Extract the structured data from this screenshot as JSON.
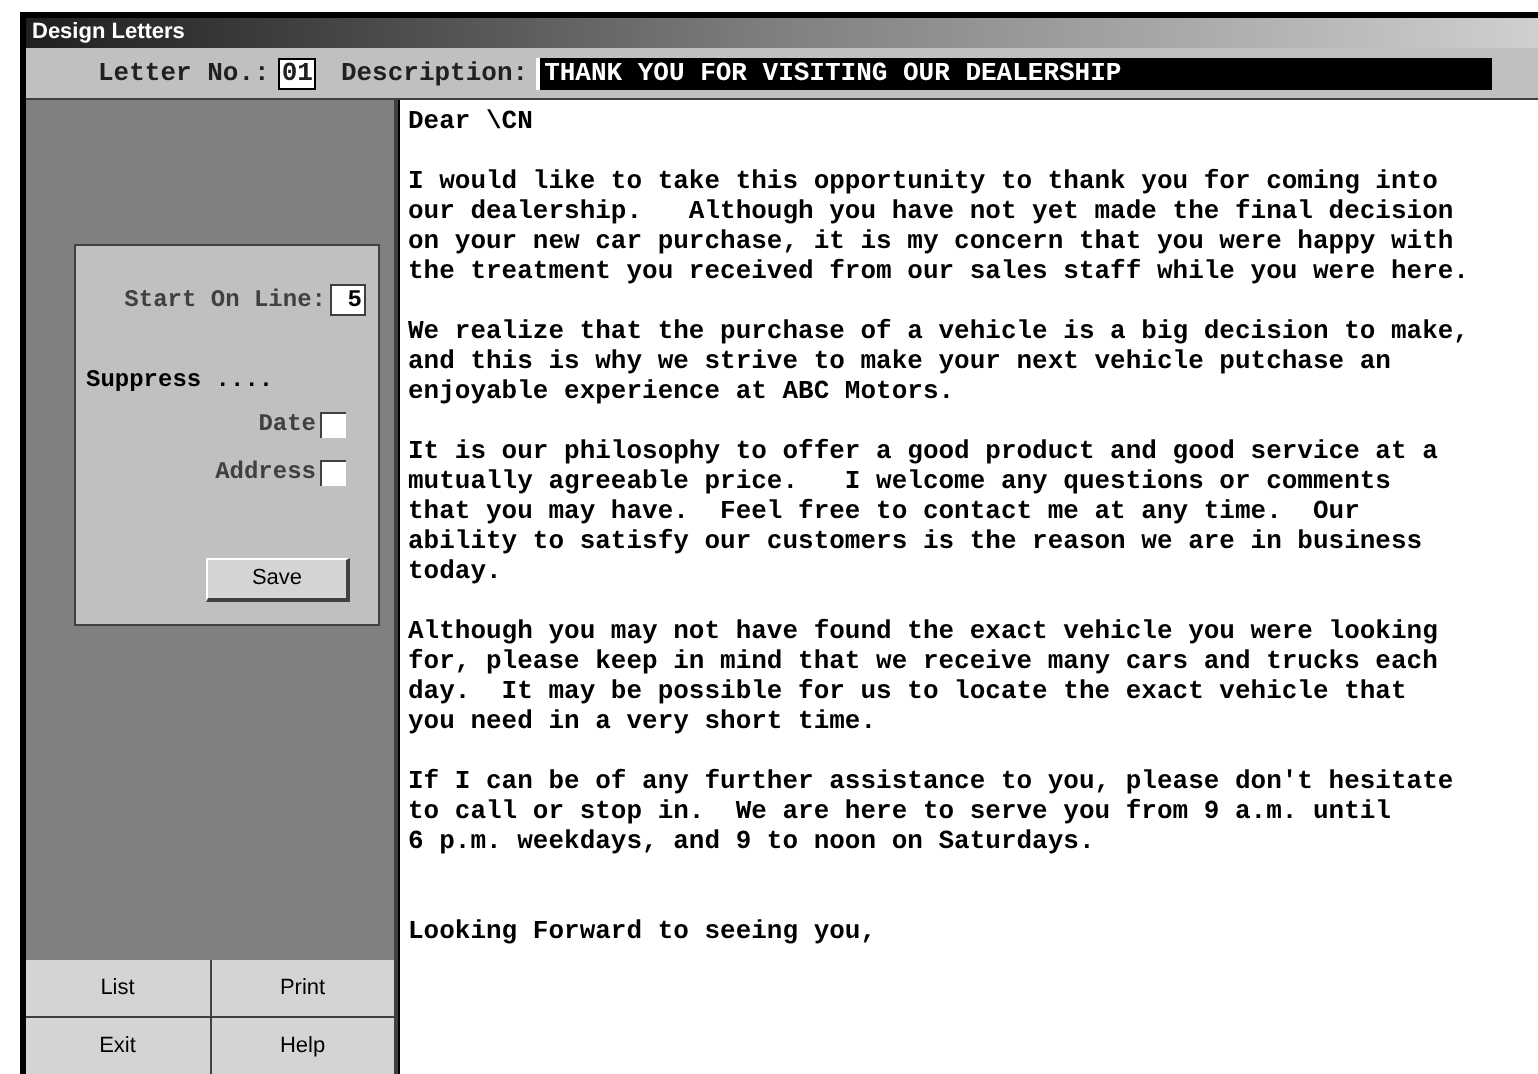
{
  "window": {
    "title": "Design Letters"
  },
  "header": {
    "letter_no_label": "Letter No.:",
    "letter_no": "01",
    "description_label": "Description:",
    "description": "THANK YOU FOR VISITING OUR DEALERSHIP"
  },
  "options": {
    "start_label": "Start On Line:",
    "start_line": "5",
    "suppress_label": "Suppress ....",
    "checks": [
      {
        "label": "Date",
        "checked": false
      },
      {
        "label": "Address",
        "checked": false
      }
    ],
    "save": "Save"
  },
  "buttons": [
    "List",
    "Print",
    "Exit",
    "Help"
  ],
  "letter": [
    {
      "kind": "salutation",
      "lines": [
        "Dear \\CN"
      ]
    },
    {
      "kind": "paragraph",
      "lines": [
        "I would like to take this opportunity to thank you for coming into",
        "our dealership.   Although you have not yet made the final decision",
        "on your new car purchase, it is my concern that you were happy with",
        "the treatment you received from our sales staff while you were here."
      ]
    },
    {
      "kind": "paragraph",
      "lines": [
        "We realize that the purchase of a vehicle is a big decision to make,",
        "and this is why we strive to make your next vehicle putchase an",
        "enjoyable experience at ABC Motors."
      ]
    },
    {
      "kind": "paragraph",
      "lines": [
        "It is our philosophy to offer a good product and good service at a",
        "mutually agreeable price.   I welcome any questions or comments",
        "that you may have.  Feel free to contact me at any time.  Our",
        "ability to satisfy our customers is the reason we are in business",
        "today."
      ]
    },
    {
      "kind": "paragraph",
      "lines": [
        "Although you may not have found the exact vehicle you were looking",
        "for, please keep in mind that we receive many cars and trucks each",
        "day.  It may be possible for us to locate the exact vehicle that",
        "you need in a very short time."
      ]
    },
    {
      "kind": "paragraph",
      "lines": [
        "If I can be of any further assistance to you, please don't hesitate",
        "to call or stop in.  We are here to serve you from 9 a.m. until",
        "6 p.m. weekdays, and 9 to noon on Saturdays."
      ]
    },
    {
      "kind": "closing",
      "lines": [
        "Looking Forward to seeing you,"
      ]
    }
  ]
}
